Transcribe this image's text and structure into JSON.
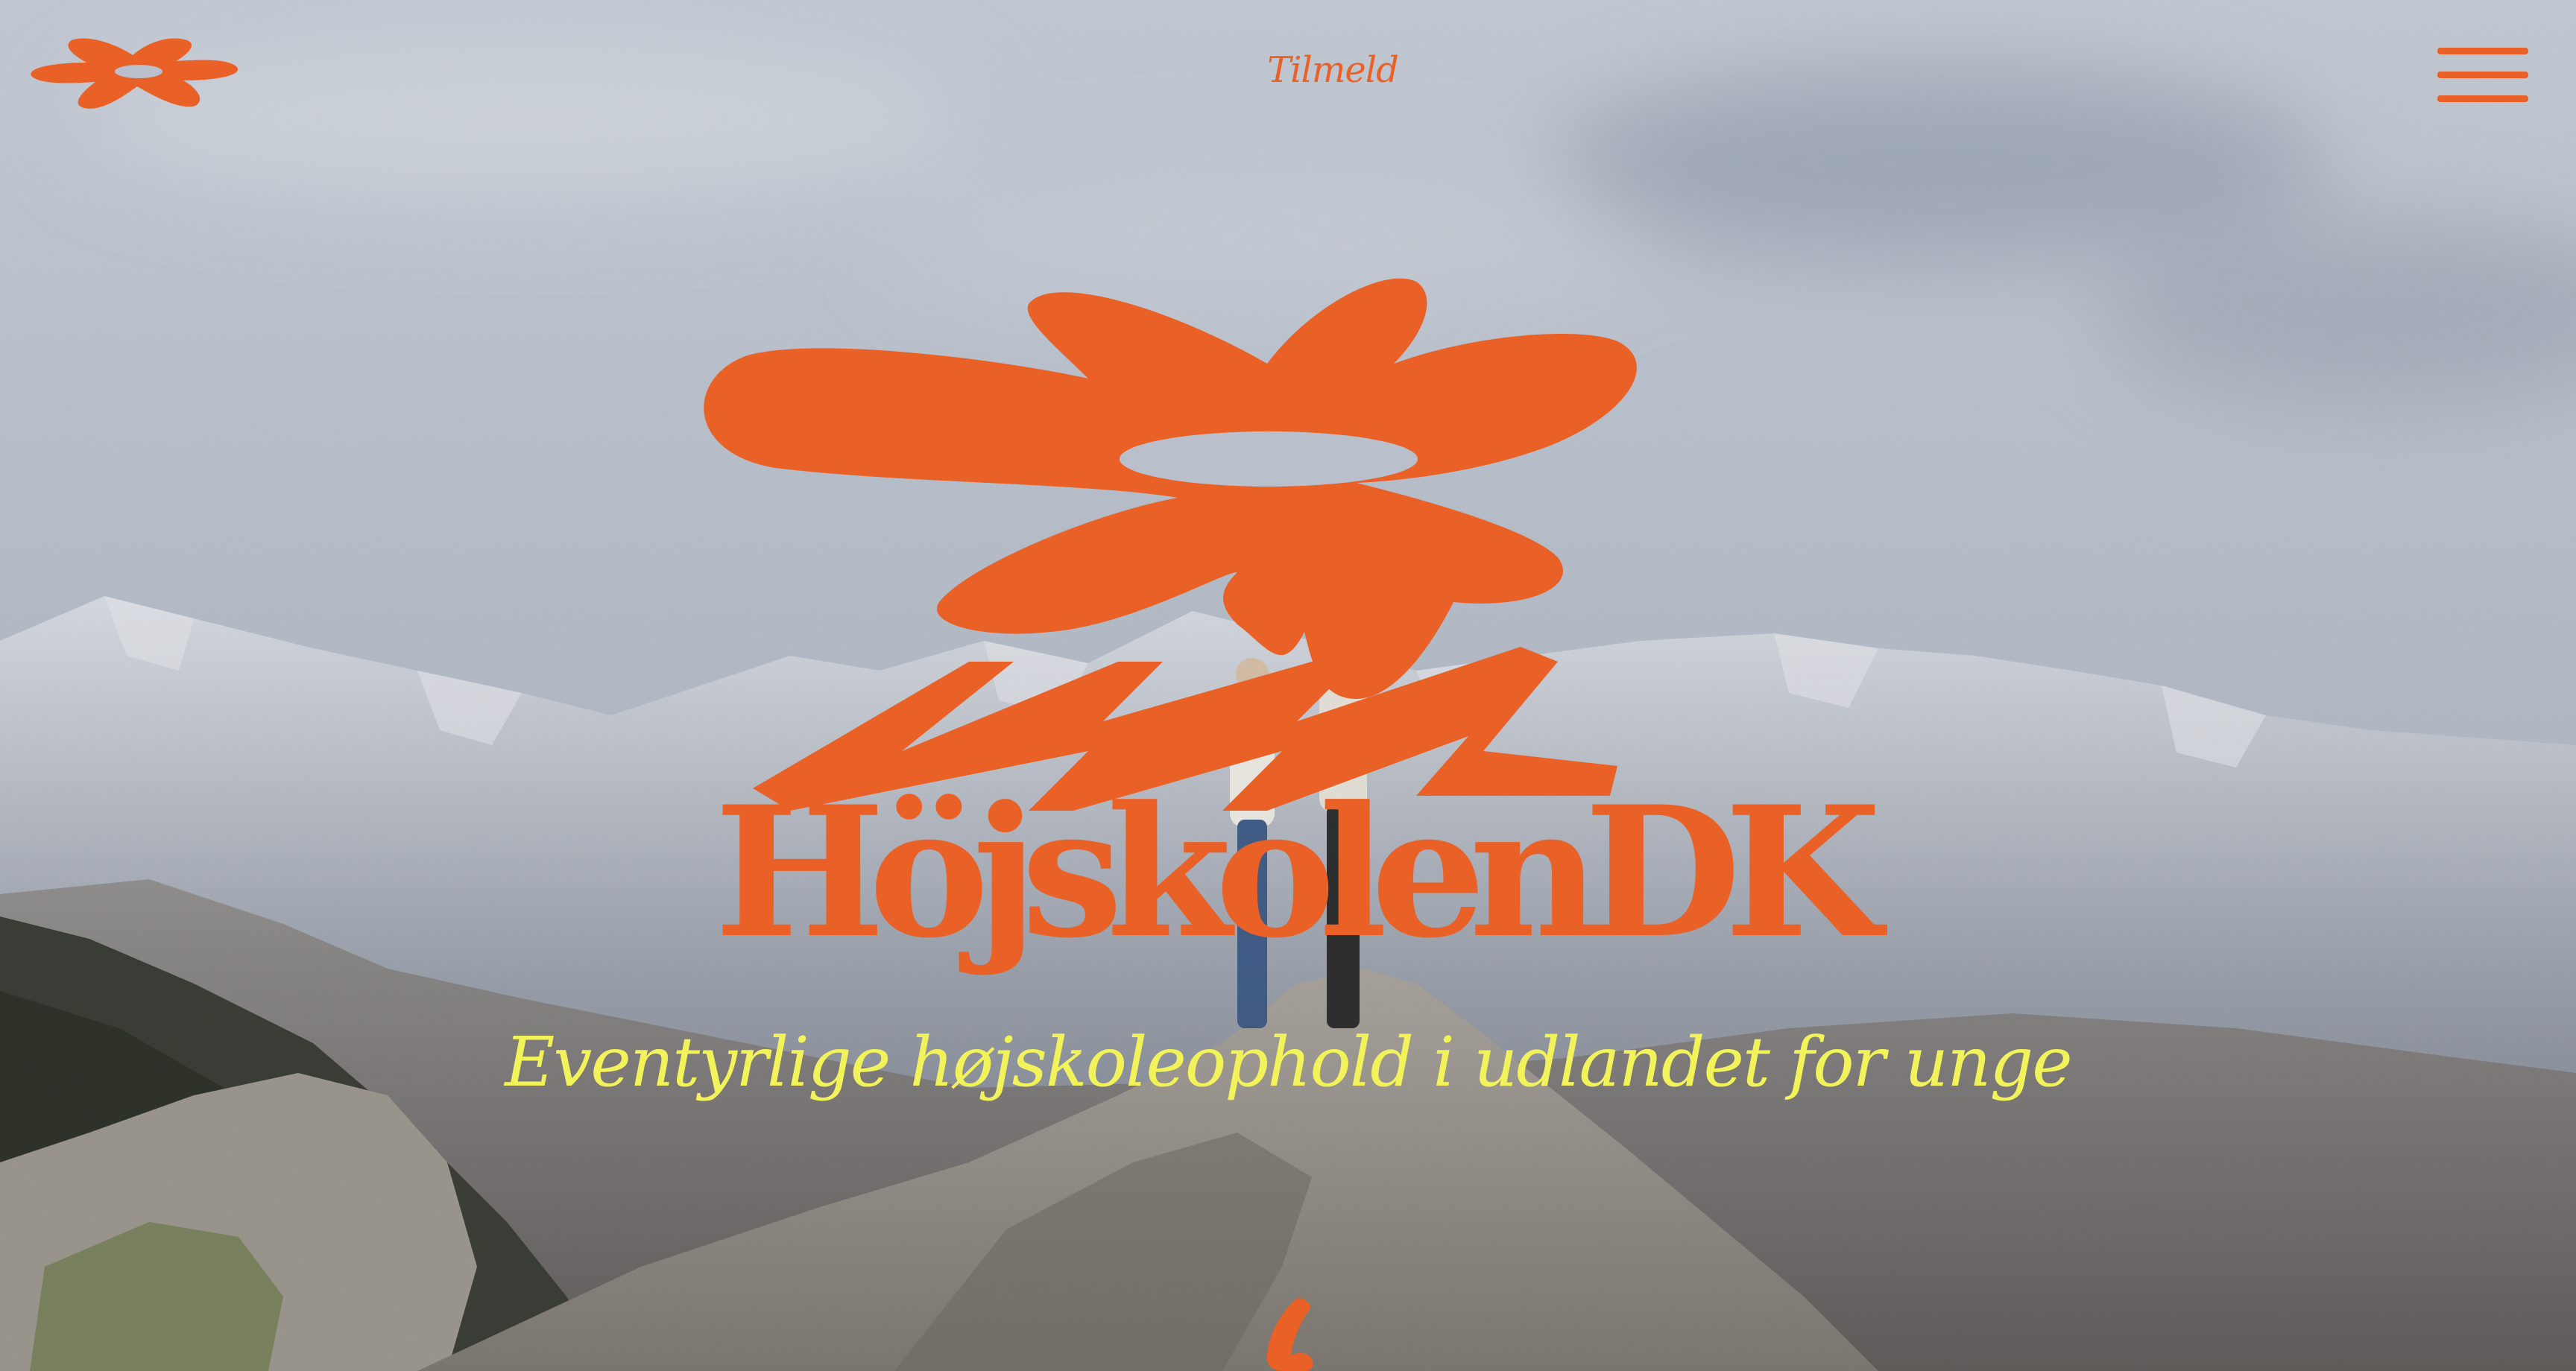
{
  "header": {
    "logo_icon": "flower-logo-icon",
    "signup_label": "Tilmeld",
    "menu_icon": "hamburger-menu-icon"
  },
  "hero": {
    "brand_name": "HöjskolenDK",
    "tagline": "Eventyrlige højskoleophold i udlandet for unge",
    "background": "mountain-summit-photo",
    "scroll_icon": "scroll-down-icon"
  },
  "colors": {
    "accent": "#ea6128",
    "tagline": "#f2f35a",
    "sky": "#b9c0cb",
    "rock": "#8c8a86"
  }
}
